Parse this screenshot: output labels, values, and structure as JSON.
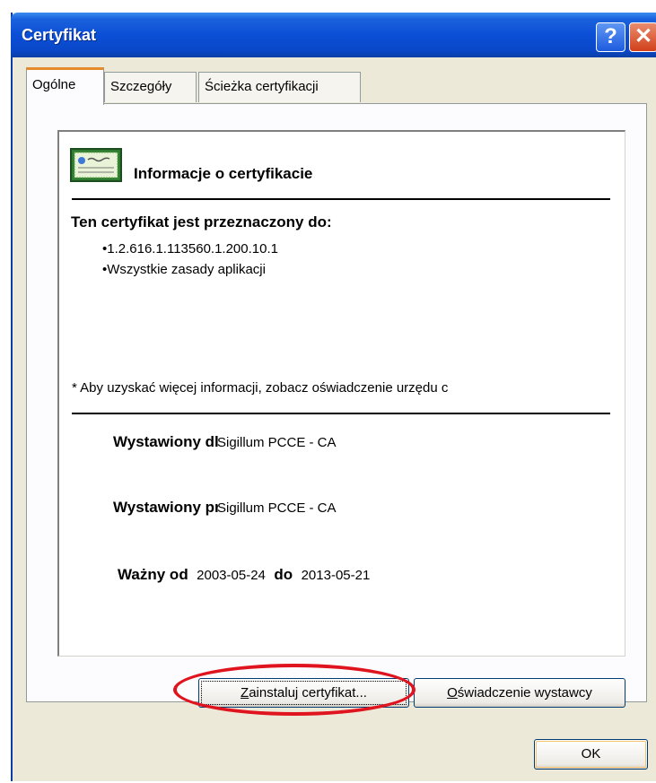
{
  "window": {
    "title": "Certyfikat",
    "help_label": "?",
    "close_label": "✕"
  },
  "tabs": [
    {
      "label": "Ogólne",
      "active": true
    },
    {
      "label": "Szczegóły",
      "active": false
    },
    {
      "label": "Ścieżka certyfikacji",
      "active": false
    }
  ],
  "general": {
    "info_title": "Informacje o certyfikacie",
    "purpose_heading": "Ten certyfikat jest przeznaczony do:",
    "purposes": [
      "•1.2.616.1.113560.1.200.10.1",
      "•Wszystkie zasady aplikacji"
    ],
    "note": "* Aby uzyskać więcej informacji, zobacz oświadczenie urzędu c",
    "issued_to_label": "Wystawiony dla:",
    "issued_to_value": "Sigillum PCCE - CA",
    "issued_by_label": "Wystawiony przez:",
    "issued_by_value": "Sigillum PCCE - CA",
    "valid_from_label": "Ważny od",
    "valid_from": "2003-05-24",
    "valid_to_label": "do",
    "valid_to": "2013-05-21"
  },
  "buttons": {
    "install_mnemonic": "Z",
    "install_rest": "ainstaluj certyfikat...",
    "issuer_mnemonic": "O",
    "issuer_rest": "świadczenie wystawcy",
    "ok": "OK"
  },
  "icons": {
    "help": "help-icon",
    "close": "close-icon",
    "certificate": "certificate-icon"
  },
  "colors": {
    "titlebar": "#0a4fd6",
    "close": "#d2401a",
    "highlight": "#e0141e",
    "active_tab": "#e68b2c"
  }
}
